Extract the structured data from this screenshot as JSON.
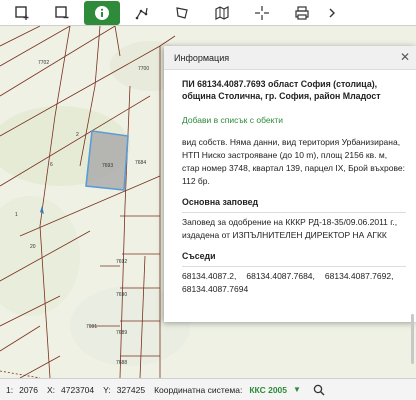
{
  "toolbar": {
    "tools": [
      {
        "icon": "select-area-icon"
      },
      {
        "icon": "deselect-area-icon"
      },
      {
        "icon": "info-icon",
        "active": true
      },
      {
        "icon": "draw-line-icon"
      },
      {
        "icon": "measure-polygon-icon"
      },
      {
        "icon": "map-layers-icon"
      },
      {
        "icon": "crosshair-icon"
      },
      {
        "icon": "print-icon"
      },
      {
        "icon": "chevron-right-icon"
      }
    ]
  },
  "map": {
    "parcel_labels": [
      "7702",
      "7700",
      "7684",
      "7693",
      "7692",
      "7690",
      "7691",
      "7689",
      "7688",
      "2",
      "6",
      "1",
      "20"
    ],
    "selected_parcel": "7693"
  },
  "popup": {
    "header": "Информация",
    "title": "ПИ 68134.4087.7693 област София (столица), община Столична, гр. София, район Младост",
    "add_link": "Добави в списък с обекти",
    "description": "вид собств. Няма данни, вид територия Урбанизирана, НТП Ниско застрояване (до 10 m), площ 2156 кв. м, стар номер 3748, квартал 139, парцел IX, Брой въхрове: 112 бр.",
    "order_title": "Основна заповед",
    "order_text": "Заповед за одобрение на КККР РД-18-35/09.06.2011 г., издадена от ИЗПЪЛНИТЕЛЕН ДИРЕКТОР НА АГКК",
    "neighbors_title": "Съседи",
    "neighbors": [
      "68134.4087.2,",
      "68134.4087.7684,",
      "68134.4087.7692,",
      "68134.4087.7694"
    ]
  },
  "status": {
    "scale_label": "1:",
    "scale_value": "2076",
    "x_label": "X:",
    "x_value": "4723704",
    "y_label": "Y:",
    "y_value": "327425",
    "coord_label": "Координатна система:",
    "coord_system": "ККС 2005"
  },
  "colors": {
    "accent": "#2e8b3a",
    "parcel_line": "#7a3020",
    "selected_fill": "#a9a9a9",
    "selected_outline": "#5b9bd5"
  }
}
